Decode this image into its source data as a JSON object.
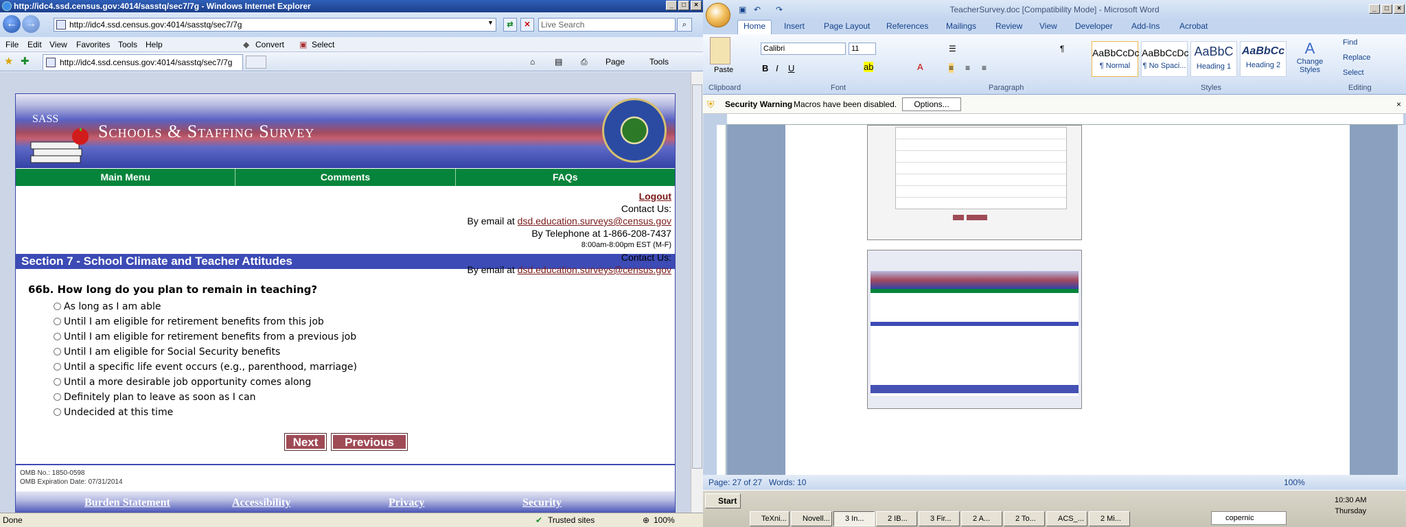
{
  "ie": {
    "title": "http://idc4.ssd.census.gov:4014/sasstq/sec7/7g - Windows Internet Explorer",
    "url": "http://idc4.ssd.census.gov:4014/sasstq/sec7/7g",
    "search_placeholder": "Live Search",
    "menu": [
      "File",
      "Edit",
      "View",
      "Favorites",
      "Tools",
      "Help"
    ],
    "convert": "Convert",
    "select": "Select",
    "tab_title": "http://idc4.ssd.census.gov:4014/sasstq/sec7/7g",
    "page_menu": "Page",
    "tools_menu": "Tools",
    "status": "Done",
    "zone": "Trusted sites",
    "zoom": "100%"
  },
  "survey": {
    "sass": "SASS",
    "title": "Schools & Staffing Survey",
    "seal": "DEPARTMENT OF EDUCATION · UNITED STATES OF AMERICA",
    "nav": [
      "Main Menu",
      "Comments",
      "FAQs"
    ],
    "logout": "Logout",
    "contact_label": "Contact Us:",
    "by_email": "By email at",
    "email": "dsd.education.surveys@census.gov",
    "by_phone": "By Telephone at 1-866-208-7437",
    "hours": "8:00am-8:00pm EST (M-F)",
    "section": "Section 7 - School Climate and Teacher Attitudes",
    "question": "66b. How long do you plan to remain in teaching?",
    "options": [
      "As long as I am able",
      "Until I am eligible for retirement benefits from this job",
      "Until I am eligible for retirement benefits from a previous job",
      "Until I am eligible for Social Security benefits",
      "Until a specific life event occurs (e.g., parenthood, marriage)",
      "Until a more desirable job opportunity comes along",
      "Definitely plan to leave as soon as I can",
      "Undecided at this time"
    ],
    "next": "Next",
    "previous": "Previous",
    "omb_no": "OMB No.: 1850-0598",
    "omb_exp": "OMB Expiration Date: 07/31/2014",
    "footer": [
      "Burden Statement",
      "Accessibility",
      "Privacy",
      "Security"
    ]
  },
  "word": {
    "title": "TeacherSurvey.doc [Compatibility Mode] - Microsoft Word",
    "tabs": [
      "Home",
      "Insert",
      "Page Layout",
      "References",
      "Mailings",
      "Review",
      "View",
      "Developer",
      "Add-Ins",
      "Acrobat"
    ],
    "paste": "Paste",
    "clipboard": "Clipboard",
    "font_name": "Calibri",
    "font_size": "11",
    "font_group": "Font",
    "paragraph_group": "Paragraph",
    "styles_group": "Styles",
    "editing_group": "Editing",
    "styles": [
      {
        "preview": "AaBbCcDc",
        "name": "¶ Normal"
      },
      {
        "preview": "AaBbCcDc",
        "name": "¶ No Spaci..."
      },
      {
        "preview": "AaBbC",
        "name": "Heading 1"
      },
      {
        "preview": "AaBbCc",
        "name": "Heading 2"
      }
    ],
    "change_styles": "Change Styles",
    "find": "Find",
    "replace": "Replace",
    "select": "Select",
    "security_warning": "Security Warning",
    "macros_msg": "Macros have been disabled.",
    "options": "Options...",
    "page_status": "Page: 27 of 27",
    "words": "Words: 10",
    "zoom": "100%"
  },
  "taskbar": {
    "start": "Start",
    "tasks": [
      "TeXni...",
      "Novell...",
      "3 In...",
      "2 IB...",
      "3 Fir...",
      "2 A...",
      "2 To...",
      "ACS_...",
      "2 Mi..."
    ],
    "search": "copernic",
    "time": "10:30 AM",
    "day": "Thursday"
  }
}
